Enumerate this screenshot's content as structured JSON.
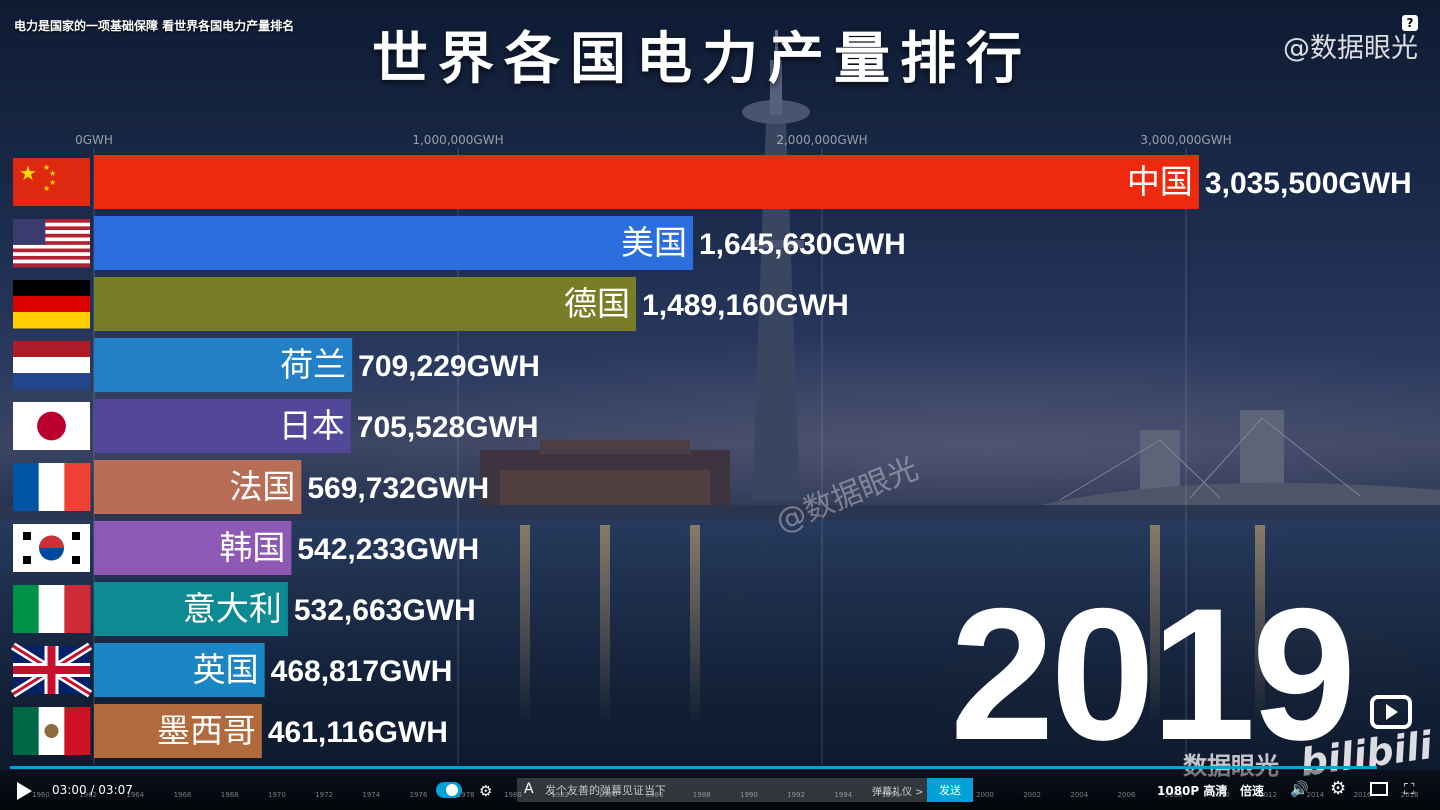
{
  "video": {
    "title": "电力是国家的一项基础保障 看世界各国电力产量排名",
    "watermark_top": "@数据眼光",
    "watermark_mid": "@数据眼光",
    "help_label": "?",
    "brand_name": "数据眼光",
    "brand_logo": "bilibili"
  },
  "chart_data": {
    "type": "bar",
    "orientation": "horizontal",
    "title": "世界各国电力产量排行",
    "year": "2019",
    "unit": "GWH",
    "xlim": [
      0,
      3300000
    ],
    "xticks": [
      0,
      1000000,
      2000000,
      3000000
    ],
    "xtick_labels": [
      "0GWH",
      "1,000,000GWH",
      "2,000,000GWH",
      "3,000,000GWH"
    ],
    "grid": true,
    "categories": [
      "中国",
      "美国",
      "德国",
      "荷兰",
      "日本",
      "法国",
      "韩国",
      "意大利",
      "英国",
      "墨西哥"
    ],
    "values": [
      3035500,
      1645630,
      1489160,
      709229,
      705528,
      569732,
      542233,
      532663,
      468817,
      461116
    ],
    "value_labels": [
      "3,035,500GWH",
      "1,645,630GWH",
      "1,489,160GWH",
      "709,229GWH",
      "705,528GWH",
      "569,732GWH",
      "542,233GWH",
      "532,663GWH",
      "468,817GWH",
      "461,116GWH"
    ],
    "colors": [
      "#ee2a0e",
      "#2b6fdf",
      "#7a7d28",
      "#2380c6",
      "#53479a",
      "#b86d57",
      "#8e58b5",
      "#0e8a92",
      "#1a86c4",
      "#b06a3d"
    ],
    "flags": [
      "china-flag-icon",
      "usa-flag-icon",
      "germany-flag-icon",
      "netherlands-flag-icon",
      "japan-flag-icon",
      "france-flag-icon",
      "korea-flag-icon",
      "italy-flag-icon",
      "uk-flag-icon",
      "mexico-flag-icon"
    ]
  },
  "player": {
    "current_time": "03:00",
    "separator": "/",
    "total_time": "03:07",
    "danmaku_placeholder": "发个友善的弹幕见证当下",
    "etiquette_label": "弹幕礼仪 >",
    "send_label": "发送",
    "quality_label": "1080P 高清",
    "speed_label": "倍速",
    "timeline_years": [
      "1960",
      "1962",
      "1964",
      "1966",
      "1968",
      "1970",
      "1972",
      "1974",
      "1976",
      "1978",
      "1980",
      "1982",
      "1984",
      "1986",
      "1988",
      "1990",
      "1992",
      "1994",
      "1996",
      "1998",
      "2000",
      "2002",
      "2004",
      "2006",
      "2008",
      "2010",
      "2012",
      "2014",
      "2016",
      "2018"
    ],
    "progress": 0.963,
    "accent_color": "#00a1d6"
  }
}
